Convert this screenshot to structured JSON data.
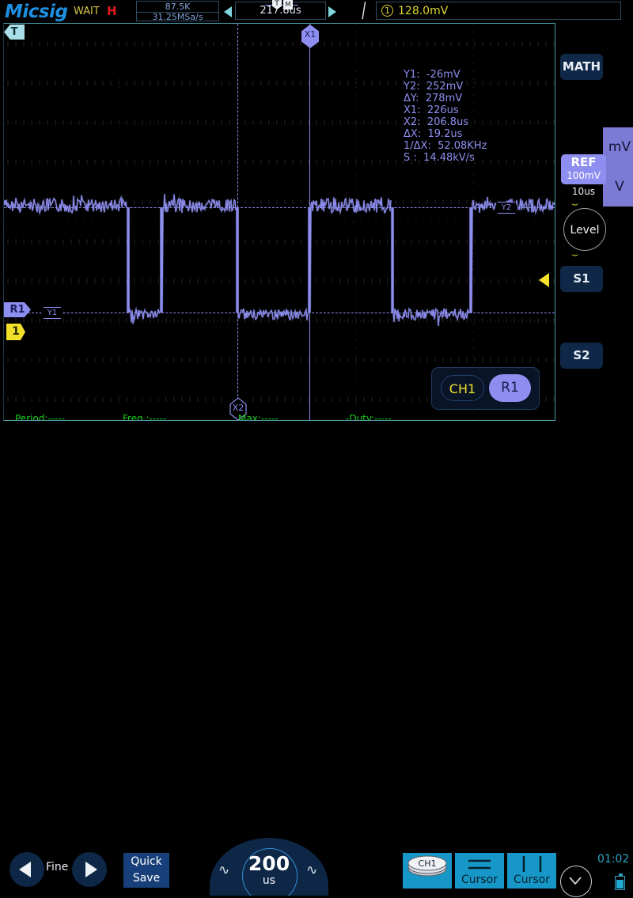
{
  "header": {
    "logo": "Micsig",
    "status": "WAIT",
    "trigger_mode": "H",
    "memory_depth": "87.5K",
    "sample_rate": "31.25MSa/s",
    "timebase_position": "217.8us",
    "trigger_marker": "T",
    "trigger_mode_marker": "M",
    "trigger_slope_icon": "falling-edge-icon",
    "trigger_channel": "1",
    "trigger_level": "128.0mV"
  },
  "plot": {
    "trigger_point_label": "T",
    "ref_marker_label": "R1",
    "channel_marker_label": "1",
    "cursor_tags": {
      "x1": "X1",
      "x2": "X2",
      "y1": "Y1",
      "y2": "Y2"
    }
  },
  "readout": {
    "lines": [
      "Y1:  -26mV",
      "Y2:  252mV",
      "ΔY:  278mV",
      "X1:  226us",
      "X2:  206.8us",
      "ΔX:  19.2us",
      "1/ΔX:  52.08KHz",
      "S :  14.48kV/s"
    ]
  },
  "measurements": [
    {
      "label": "Period:-----"
    },
    {
      "label": "Freq.:-----"
    },
    {
      "label": "Max:-----"
    },
    {
      "label": "-Duty:-----"
    }
  ],
  "source_panel": {
    "channel_label": "CH1",
    "ref_label": "R1"
  },
  "sidebar": {
    "math_label": "MATH",
    "ref_label": "REF",
    "ref_scale": "100mV",
    "ref_timebase": "10us",
    "unit_mv": "mV",
    "unit_v": "V",
    "level_label": "Level",
    "arc_up": "⌣",
    "arc_down": "⌣",
    "s1_label": "S1",
    "s2_label": "S2"
  },
  "bottom": {
    "prev_icon": "play-left-icon",
    "fine_label": "Fine",
    "next_icon": "play-right-icon",
    "quick_save_line1": "Quick",
    "quick_save_line2": "Save",
    "timebase_value": "200",
    "timebase_unit": "us",
    "wave_left_icon": "waveform-icon",
    "wave_right_icon": "waveform-icon",
    "channel_button_label": "CH1",
    "h_cursor_label": "Cursor",
    "v_cursor_label": "Cursor",
    "chevron_icon": "chevron-down-icon",
    "clock": "01:02",
    "battery_icon": "battery-icon"
  },
  "colors": {
    "brand": "#1e8fe0",
    "waveform": "#8e8ef0",
    "cursor": "#8e8ef0",
    "measure": "#18d018",
    "trigger": "#ddd62e",
    "accent_cyan": "#1797c8"
  }
}
